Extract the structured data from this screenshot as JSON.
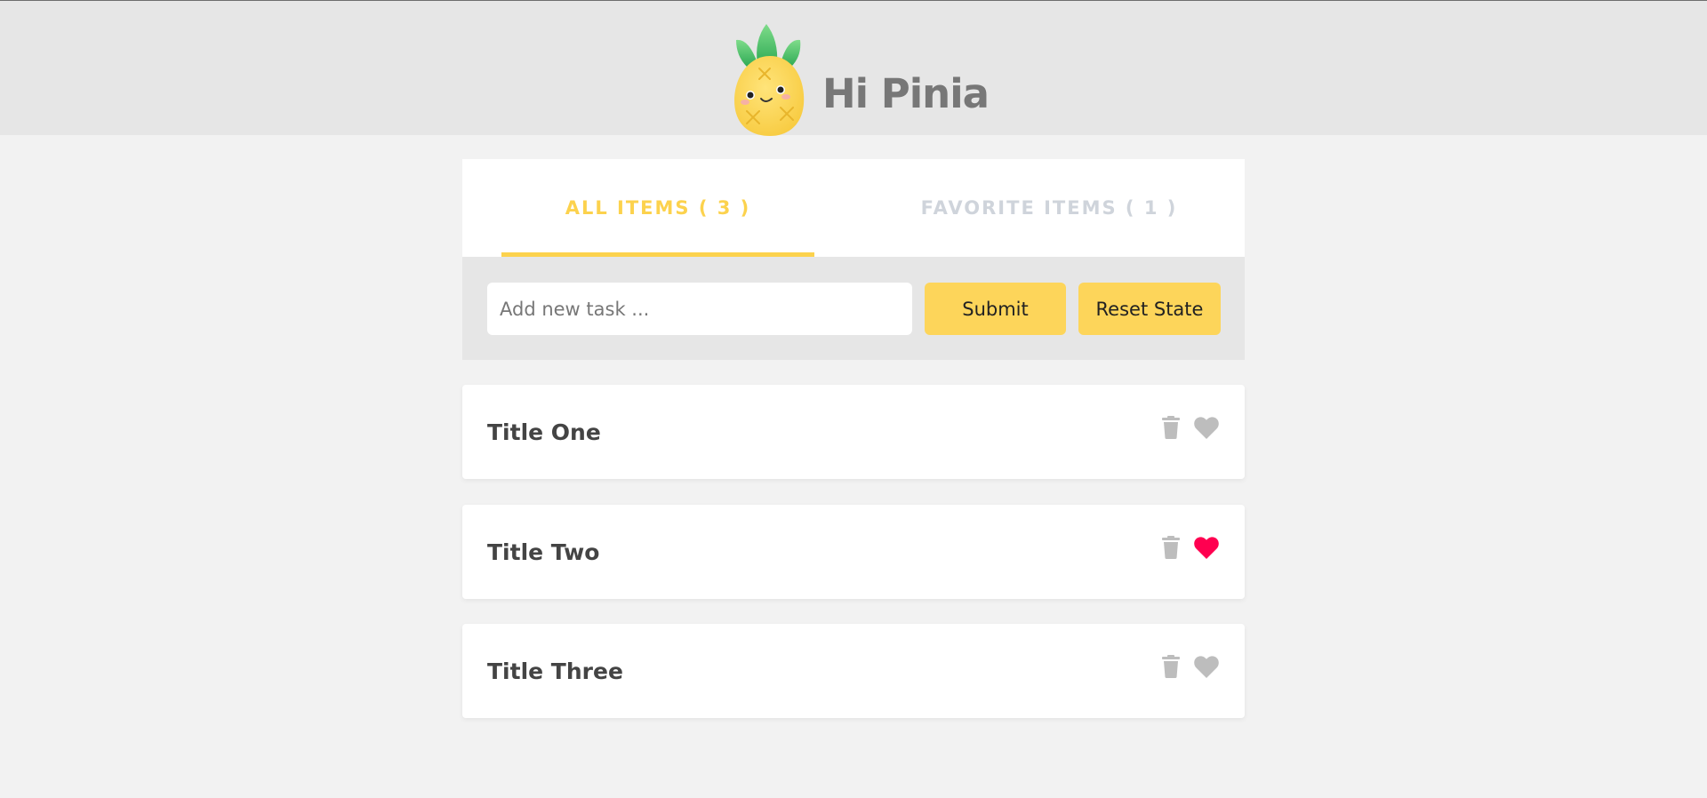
{
  "header": {
    "brand": "Hi Pinia"
  },
  "tabs": [
    {
      "label": "ALL ITEMS ( 3 )",
      "active": true
    },
    {
      "label": "FAVORITE ITEMS ( 1 )",
      "active": false
    }
  ],
  "form": {
    "placeholder": "Add new task ...",
    "value": "",
    "submit_label": "Submit",
    "reset_label": "Reset State"
  },
  "items": [
    {
      "title": "Title One",
      "favorite": false
    },
    {
      "title": "Title Two",
      "favorite": true
    },
    {
      "title": "Title Three",
      "favorite": false
    }
  ],
  "colors": {
    "accent": "#fcd24d",
    "favorite": "#ff0050",
    "icon_gray": "#bdbdbd",
    "header_bg": "#e6e6e6"
  }
}
